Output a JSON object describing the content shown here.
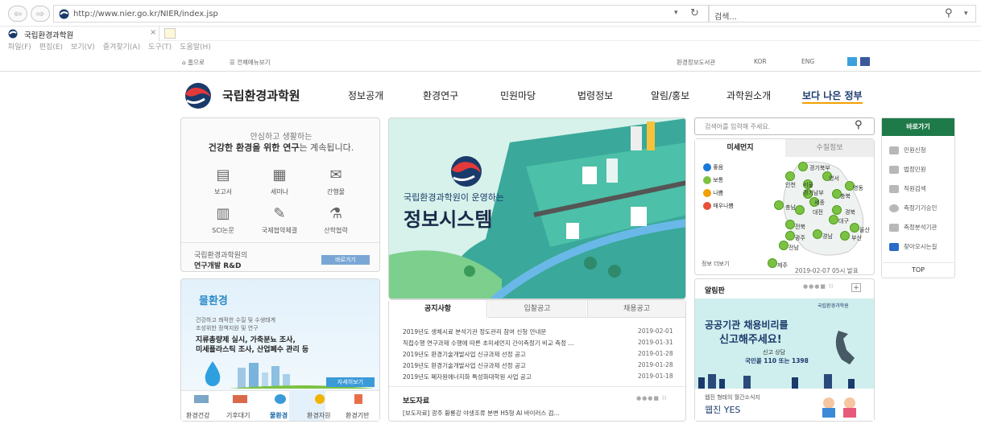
{
  "browser": {
    "url": "http://www.nier.go.kr/NIER/index.jsp",
    "search_placeholder": "검색...",
    "tab_title": "국립환경과학원",
    "menu": [
      "파일(F)",
      "편집(E)",
      "보기(V)",
      "즐겨찾기(A)",
      "도구(T)",
      "도움말(H)"
    ]
  },
  "util": {
    "home": "홈으로",
    "allmenu": "전체메뉴보기",
    "right": [
      "환경정보도서관",
      "KOR",
      "ENG"
    ]
  },
  "header": {
    "site_name": "국립환경과학원",
    "nav": [
      "정보공개",
      "환경연구",
      "민원마당",
      "법령정보",
      "알림/홍보",
      "과학원소개"
    ],
    "slogan": "보다 나은 정부"
  },
  "intro": {
    "line1": "안심하고 생활하는",
    "line2_bold": "건강한 환경을 위한 연구",
    "line2_rest": "는 계속됩니다.",
    "icons": [
      "보고서",
      "세미나",
      "간행물",
      "SCI논문",
      "국제협약체결",
      "산학협력"
    ],
    "rnd_line1": "국립환경과학원의",
    "rnd_line2": "연구개발 R&D",
    "rnd_btn": "바로가기"
  },
  "water": {
    "title": "물환경",
    "sub1": "건강하고 쾌적한 수질 및 수생태계",
    "sub2": "조성위한 정책지원 및 연구",
    "bold1": "지류총량제 실시, 가축분뇨 조사,",
    "bold2": "미세플라스틱 조사, 산업폐수 관리 등",
    "more": "자세히보기",
    "tabs": [
      "환경건강",
      "기후대기",
      "물환경",
      "환경자원",
      "환경기반"
    ]
  },
  "banner": {
    "line1": "국립환경과학원이 운영하는",
    "line2": "정보시스템"
  },
  "notice": {
    "tabs": [
      "공지사항",
      "입찰공고",
      "채용공고"
    ],
    "rows": [
      {
        "title": "2019년도 생체시료 분석기관 정도관리 참여 신청 안내문",
        "date": "2019-02-01"
      },
      {
        "title": "직접수행 연구과제 수행에 따른 초미세먼지 간이측정기 비교 측정 ...",
        "date": "2019-01-31"
      },
      {
        "title": "2019년도 환경기술개발사업 신규과제 선정 공고",
        "date": "2019-01-28"
      },
      {
        "title": "2019년도 환경기술개발사업 신규과제 선정 공고",
        "date": "2019-01-28"
      },
      {
        "title": "2019년도 폐자원에너지화 특성화대학원 사업 공고",
        "date": "2019-01-18"
      }
    ],
    "press_title": "보도자료",
    "press_row": "[보도자료] 광주 황룡강 야생조류 분변 H5형 AI 바이러스 검..."
  },
  "air": {
    "search_placeholder": "검색어를 입력해 주세요.",
    "tabs": [
      "미세먼지",
      "수질정보"
    ],
    "legend": [
      "좋음",
      "보통",
      "나쁨",
      "매우나쁨"
    ],
    "cities": [
      "경기북부",
      "인천",
      "서울",
      "영서",
      "경기남부",
      "영동",
      "세종",
      "충북",
      "충남",
      "대전",
      "경북",
      "대구",
      "전북",
      "울산",
      "광주",
      "경남",
      "부산",
      "전남",
      "제주"
    ],
    "more": "정보 더보기",
    "timestamp": "2019-02-07 05시 발표"
  },
  "board": {
    "title": "알림판",
    "org": "국립환경과학원",
    "line1": "공공기관 채용비리를",
    "line2": "신고해주세요!",
    "center": "신고 상담",
    "phone": "국민콜 110 또는 1398",
    "webzine_sub": "웹진 형태의 월간소식지",
    "webzine": "웹진 YES"
  },
  "quick": {
    "title": "바로가기",
    "items": [
      "민원신청",
      "법정민원",
      "직원검색",
      "측정기기승인",
      "측정분석기관",
      "찾아오시는길"
    ],
    "top": "TOP"
  },
  "colors": {
    "brand_green": "#1f7a4a",
    "navy": "#1a3a6b",
    "teal": "#20a6a0",
    "map_green": "#7cc242"
  }
}
